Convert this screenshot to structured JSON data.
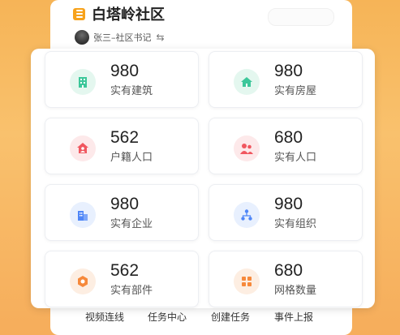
{
  "header": {
    "title": "白塔岭社区",
    "user": "张三–社区书记"
  },
  "stats": [
    {
      "value": "980",
      "label": "实有建筑",
      "icon": "building-icon",
      "color": "#3cc79a",
      "bg": "#e4f7ef"
    },
    {
      "value": "980",
      "label": "实有房屋",
      "icon": "house-icon",
      "color": "#3cc79a",
      "bg": "#e4f7ef"
    },
    {
      "value": "562",
      "label": "户籍人口",
      "icon": "household-icon",
      "color": "#f0575f",
      "bg": "#fde9ea"
    },
    {
      "value": "680",
      "label": "实有人口",
      "icon": "people-icon",
      "color": "#f0575f",
      "bg": "#fde9ea"
    },
    {
      "value": "980",
      "label": "实有企业",
      "icon": "enterprise-icon",
      "color": "#4f86f7",
      "bg": "#e8f0fe"
    },
    {
      "value": "980",
      "label": "实有组织",
      "icon": "organization-icon",
      "color": "#4f86f7",
      "bg": "#e8f0fe"
    },
    {
      "value": "562",
      "label": "实有部件",
      "icon": "component-icon",
      "color": "#f6893b",
      "bg": "#fdeee2"
    },
    {
      "value": "680",
      "label": "网格数量",
      "icon": "grid-icon",
      "color": "#f6893b",
      "bg": "#fdeee2"
    }
  ],
  "bottom_nav": [
    "视频连线",
    "任务中心",
    "创建任务",
    "事件上报"
  ]
}
